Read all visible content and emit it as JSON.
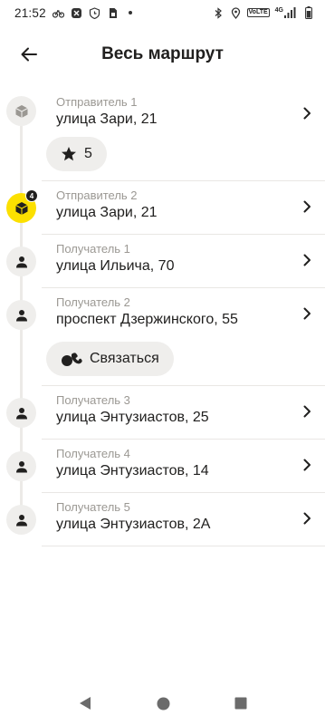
{
  "status_bar": {
    "time": "21:52",
    "volte": "VoLTE",
    "network": "4G"
  },
  "header": {
    "title": "Весь маршрут"
  },
  "stops": [
    {
      "label": "Отправитель 1",
      "address": "улица Зари, 21",
      "marker": "package-icon",
      "marker_color": "#efeeec"
    },
    {
      "label": "Отправитель 2",
      "address": "улица Зари, 21",
      "marker": "package-icon",
      "marker_color": "#fce000",
      "badge": "4"
    },
    {
      "label": "Получатель 1",
      "address": "улица Ильича, 70",
      "marker": "person-icon",
      "marker_color": "#efeeec"
    },
    {
      "label": "Получатель 2",
      "address": "проспект Дзержинского, 55",
      "marker": "person-icon",
      "marker_color": "#efeeec"
    },
    {
      "label": "Получатель 3",
      "address": "улица Энтузиастов, 25",
      "marker": "person-icon",
      "marker_color": "#efeeec"
    },
    {
      "label": "Получатель 4",
      "address": "улица Энтузиастов, 14",
      "marker": "person-icon",
      "marker_color": "#efeeec"
    },
    {
      "label": "Получатель 5",
      "address": "улица Энтузиастов, 2А",
      "marker": "person-icon",
      "marker_color": "#efeeec"
    }
  ],
  "chips": {
    "rating": {
      "label": "5",
      "icon": "star-icon"
    },
    "contact": {
      "label": "Связаться",
      "icon": "phone-icon"
    }
  },
  "colors": {
    "accent_yellow": "#fce000",
    "marker_grey": "#efeeec",
    "text_primary": "#21201f",
    "text_secondary": "#9b9893"
  }
}
